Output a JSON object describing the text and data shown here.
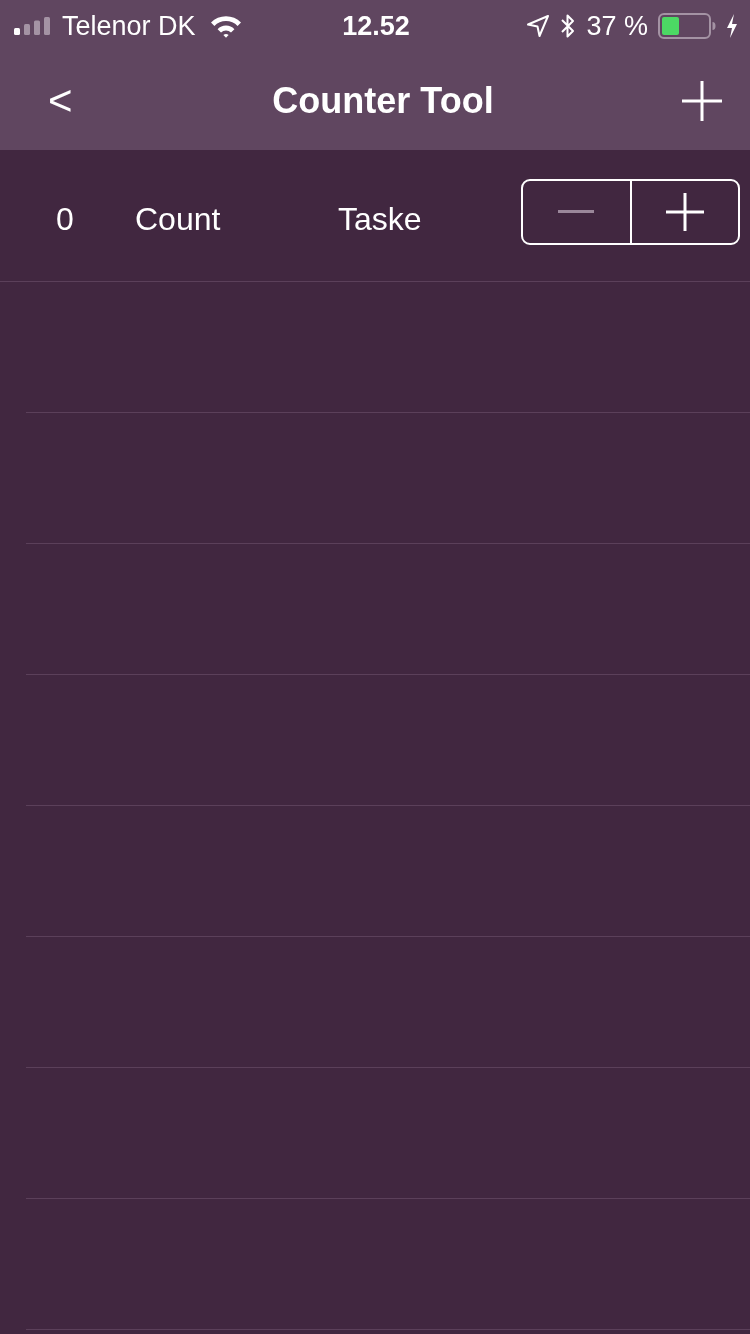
{
  "status_bar": {
    "carrier": "Telenor DK",
    "time": "12.52",
    "battery": "37 %"
  },
  "nav_bar": {
    "back": "<",
    "title": "Counter Tool"
  },
  "counters": [
    {
      "count": "0",
      "name": "Count",
      "category": "Taske",
      "decrement_disabled": true,
      "increment_disabled": false
    }
  ]
}
